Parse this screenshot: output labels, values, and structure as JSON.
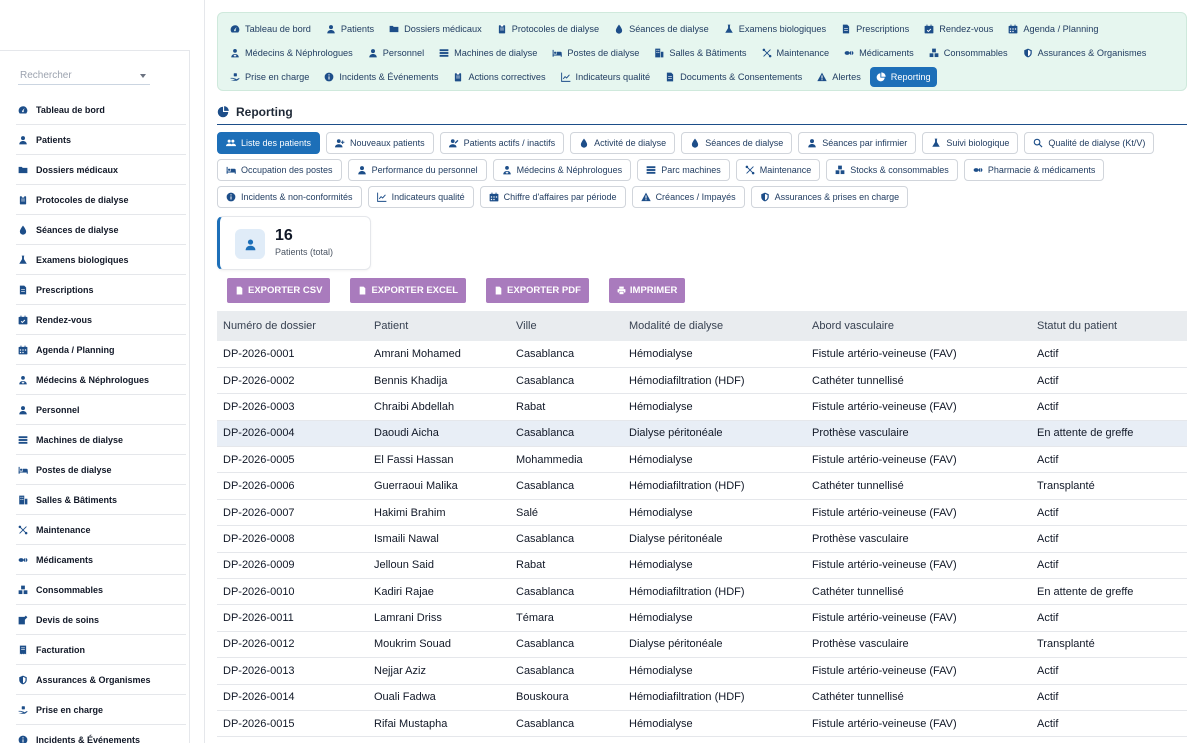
{
  "sidebar": {
    "search_placeholder": "Rechercher",
    "items": [
      {
        "label": "Tableau de bord",
        "icon": "dashboard-icon"
      },
      {
        "label": "Patients",
        "icon": "user-icon"
      },
      {
        "label": "Dossiers médicaux",
        "icon": "folder-icon"
      },
      {
        "label": "Protocoles de dialyse",
        "icon": "clipboard-icon"
      },
      {
        "label": "Séances de dialyse",
        "icon": "droplet-icon"
      },
      {
        "label": "Examens biologiques",
        "icon": "flask-icon"
      },
      {
        "label": "Prescriptions",
        "icon": "file-icon"
      },
      {
        "label": "Rendez-vous",
        "icon": "calendar-check-icon"
      },
      {
        "label": "Agenda / Planning",
        "icon": "calendar-icon"
      },
      {
        "label": "Médecins & Néphrologues",
        "icon": "doctor-icon"
      },
      {
        "label": "Personnel",
        "icon": "user-icon"
      },
      {
        "label": "Machines de dialyse",
        "icon": "machine-icon"
      },
      {
        "label": "Postes de dialyse",
        "icon": "bed-icon"
      },
      {
        "label": "Salles & Bâtiments",
        "icon": "building-icon"
      },
      {
        "label": "Maintenance",
        "icon": "tools-icon"
      },
      {
        "label": "Médicaments",
        "icon": "pills-icon"
      },
      {
        "label": "Consommables",
        "icon": "boxes-icon"
      },
      {
        "label": "Devis de soins",
        "icon": "edit-icon"
      },
      {
        "label": "Facturation",
        "icon": "invoice-icon"
      },
      {
        "label": "Assurances & Organismes",
        "icon": "shield-icon"
      },
      {
        "label": "Prise en charge",
        "icon": "hand-icon"
      },
      {
        "label": "Incidents & Événements",
        "icon": "info-icon"
      }
    ]
  },
  "topnav": {
    "rows": [
      [
        {
          "label": "Tableau de bord",
          "icon": "dashboard-icon"
        },
        {
          "label": "Patients",
          "icon": "user-icon"
        },
        {
          "label": "Dossiers médicaux",
          "icon": "folder-icon"
        },
        {
          "label": "Protocoles de dialyse",
          "icon": "clipboard-icon"
        },
        {
          "label": "Séances de dialyse",
          "icon": "droplet-icon"
        },
        {
          "label": "Examens biologiques",
          "icon": "flask-icon"
        },
        {
          "label": "Prescriptions",
          "icon": "file-icon"
        },
        {
          "label": "Rendez-vous",
          "icon": "calendar-check-icon"
        },
        {
          "label": "Agenda / Planning",
          "icon": "calendar-icon"
        }
      ],
      [
        {
          "label": "Médecins & Néphrologues",
          "icon": "doctor-icon"
        },
        {
          "label": "Personnel",
          "icon": "user-icon"
        },
        {
          "label": "Machines de dialyse",
          "icon": "machine-icon"
        },
        {
          "label": "Postes de dialyse",
          "icon": "bed-icon"
        },
        {
          "label": "Salles & Bâtiments",
          "icon": "building-icon"
        },
        {
          "label": "Maintenance",
          "icon": "tools-icon"
        },
        {
          "label": "Médicaments",
          "icon": "pills-icon"
        },
        {
          "label": "Consommables",
          "icon": "boxes-icon"
        },
        {
          "label": "Assurances & Organismes",
          "icon": "shield-icon"
        }
      ],
      [
        {
          "label": "Prise en charge",
          "icon": "hand-icon"
        },
        {
          "label": "Incidents & Événements",
          "icon": "info-icon"
        },
        {
          "label": "Actions correctives",
          "icon": "clipboard-icon"
        },
        {
          "label": "Indicateurs qualité",
          "icon": "chart-line-icon"
        },
        {
          "label": "Documents & Consentements",
          "icon": "file-icon"
        },
        {
          "label": "Alertes",
          "icon": "warning-icon"
        },
        {
          "label": "Reporting",
          "icon": "pie-chart-icon",
          "active": true
        }
      ]
    ]
  },
  "page": {
    "title": "Reporting"
  },
  "subtabs": {
    "rows": [
      [
        {
          "label": "Liste des patients",
          "icon": "users-icon",
          "active": true
        },
        {
          "label": "Nouveaux patients",
          "icon": "user-plus-icon"
        },
        {
          "label": "Patients actifs / inactifs",
          "icon": "user-edit-icon"
        },
        {
          "label": "Activité de dialyse",
          "icon": "droplet-icon"
        },
        {
          "label": "Séances de dialyse",
          "icon": "droplet-icon"
        },
        {
          "label": "Séances par infirmier",
          "icon": "user-icon"
        },
        {
          "label": "Suivi biologique",
          "icon": "flask-icon"
        },
        {
          "label": "Qualité de dialyse (Kt/V)",
          "icon": "search-icon"
        }
      ],
      [
        {
          "label": "Occupation des postes",
          "icon": "bed-icon"
        },
        {
          "label": "Performance du personnel",
          "icon": "user-icon"
        },
        {
          "label": "Médecins & Néphrologues",
          "icon": "doctor-icon"
        },
        {
          "label": "Parc machines",
          "icon": "machine-icon"
        },
        {
          "label": "Maintenance",
          "icon": "tools-icon"
        },
        {
          "label": "Stocks & consommables",
          "icon": "boxes-icon"
        },
        {
          "label": "Pharmacie & médicaments",
          "icon": "pills-icon"
        }
      ],
      [
        {
          "label": "Incidents & non-conformités",
          "icon": "info-icon"
        },
        {
          "label": "Indicateurs qualité",
          "icon": "chart-line-icon"
        },
        {
          "label": "Chiffre d'affaires par période",
          "icon": "calendar-icon"
        },
        {
          "label": "Créances / Impayés",
          "icon": "warning-icon"
        },
        {
          "label": "Assurances & prises en charge",
          "icon": "shield-icon"
        }
      ]
    ]
  },
  "stat": {
    "value": "16",
    "label": "Patients (total)",
    "icon": "user-icon"
  },
  "exports": [
    {
      "label": "EXPORTER CSV",
      "icon": "file-icon"
    },
    {
      "label": "EXPORTER EXCEL",
      "icon": "file-icon"
    },
    {
      "label": "EXPORTER PDF",
      "icon": "file-icon"
    },
    {
      "label": "IMPRIMER",
      "icon": "print-icon"
    }
  ],
  "colors": {
    "accent": "#1d6fb8",
    "export_button": "#a97bbd",
    "topnav_bg": "#e6f6ef"
  },
  "table": {
    "columns": [
      "Numéro de dossier",
      "Patient",
      "Ville",
      "Modalité de dialyse",
      "Abord vasculaire",
      "Statut du patient"
    ],
    "rows": [
      [
        "DP-2026-0001",
        "Amrani Mohamed",
        "Casablanca",
        "Hémodialyse",
        "Fistule artério-veineuse (FAV)",
        "Actif"
      ],
      [
        "DP-2026-0002",
        "Bennis Khadija",
        "Casablanca",
        "Hémodiafiltration (HDF)",
        "Cathéter tunnellisé",
        "Actif"
      ],
      [
        "DP-2026-0003",
        "Chraibi Abdellah",
        "Rabat",
        "Hémodialyse",
        "Fistule artério-veineuse (FAV)",
        "Actif"
      ],
      [
        "DP-2026-0004",
        "Daoudi Aicha",
        "Casablanca",
        "Dialyse péritonéale",
        "Prothèse vasculaire",
        "En attente de greffe"
      ],
      [
        "DP-2026-0005",
        "El Fassi Hassan",
        "Mohammedia",
        "Hémodialyse",
        "Fistule artério-veineuse (FAV)",
        "Actif"
      ],
      [
        "DP-2026-0006",
        "Guerraoui Malika",
        "Casablanca",
        "Hémodiafiltration (HDF)",
        "Cathéter tunnellisé",
        "Transplanté"
      ],
      [
        "DP-2026-0007",
        "Hakimi Brahim",
        "Salé",
        "Hémodialyse",
        "Fistule artério-veineuse (FAV)",
        "Actif"
      ],
      [
        "DP-2026-0008",
        "Ismaili Nawal",
        "Casablanca",
        "Dialyse péritonéale",
        "Prothèse vasculaire",
        "Actif"
      ],
      [
        "DP-2026-0009",
        "Jelloun Said",
        "Rabat",
        "Hémodialyse",
        "Fistule artério-veineuse (FAV)",
        "Actif"
      ],
      [
        "DP-2026-0010",
        "Kadiri Rajae",
        "Casablanca",
        "Hémodiafiltration (HDF)",
        "Cathéter tunnellisé",
        "En attente de greffe"
      ],
      [
        "DP-2026-0011",
        "Lamrani Driss",
        "Témara",
        "Hémodialyse",
        "Fistule artério-veineuse (FAV)",
        "Actif"
      ],
      [
        "DP-2026-0012",
        "Moukrim Souad",
        "Casablanca",
        "Dialyse péritonéale",
        "Prothèse vasculaire",
        "Transplanté"
      ],
      [
        "DP-2026-0013",
        "Nejjar Aziz",
        "Casablanca",
        "Hémodialyse",
        "Fistule artério-veineuse (FAV)",
        "Actif"
      ],
      [
        "DP-2026-0014",
        "Ouali Fadwa",
        "Bouskoura",
        "Hémodiafiltration (HDF)",
        "Cathéter tunnellisé",
        "Actif"
      ],
      [
        "DP-2026-0015",
        "Rifai Mustapha",
        "Casablanca",
        "Hémodialyse",
        "Fistule artério-veineuse (FAV)",
        "Actif"
      ]
    ],
    "highlight_row": 3
  }
}
